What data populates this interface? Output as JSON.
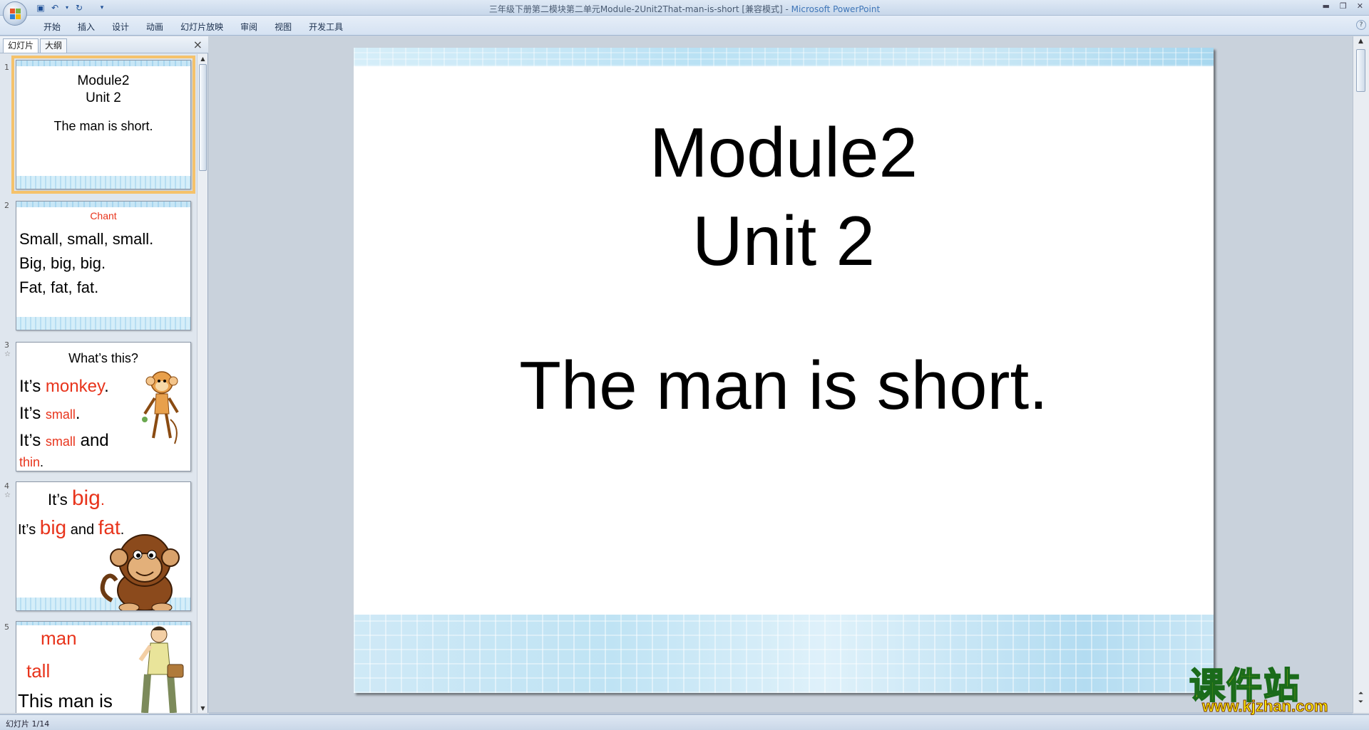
{
  "window": {
    "title_doc": "三年级下册第二模块第二单元Module-2Unit2That-man-is-short [兼容模式] - ",
    "title_app": "Microsoft PowerPoint"
  },
  "quick_access": [
    "save-icon",
    "undo-icon",
    "redo-icon",
    "customize-icon"
  ],
  "menu": {
    "tabs": [
      "开始",
      "插入",
      "设计",
      "动画",
      "幻灯片放映",
      "审阅",
      "视图",
      "开发工具"
    ]
  },
  "panel": {
    "tabs": [
      "幻灯片",
      "大纲"
    ],
    "close": "×"
  },
  "thumbnails": [
    {
      "num": "1",
      "star": "",
      "lines": [
        "Module2",
        "Unit 2",
        "The man is short."
      ]
    },
    {
      "num": "2",
      "star": "",
      "chant": "Chant",
      "lines": [
        "Small, small, small.",
        "Big, big, big.",
        "Fat, fat, fat."
      ]
    },
    {
      "num": "3",
      "star": "☆",
      "q": "What’s this?",
      "l1a": "It’s ",
      "l1b": "monkey",
      "l1c": ".",
      "l2a": "It’s ",
      "l2b": "small",
      "l2c": ".",
      "l3a": "It’s ",
      "l3b": "small",
      "l3c": " and",
      "l4b": "thin",
      "l4c": "."
    },
    {
      "num": "4",
      "star": "☆",
      "l1a": "It’s ",
      "l1b": "big",
      "l1c": ".",
      "l2a": "It’s ",
      "l2b": "big",
      "l2c": " and ",
      "l2d": "fat",
      "l2e": "."
    },
    {
      "num": "5",
      "star": "",
      "w1": "man",
      "w2": "tall",
      "l3": "This man is"
    }
  ],
  "slide": {
    "line1": "Module2",
    "line2": "Unit 2",
    "line3": "The man is short."
  },
  "status": {
    "slide_counter": "幻灯片 1/14"
  },
  "watermark": {
    "cn": "课件站",
    "url": "www.kjzhan.com"
  },
  "colors": {
    "accent_red": "#e8341c",
    "selection": "#f5c26b"
  }
}
